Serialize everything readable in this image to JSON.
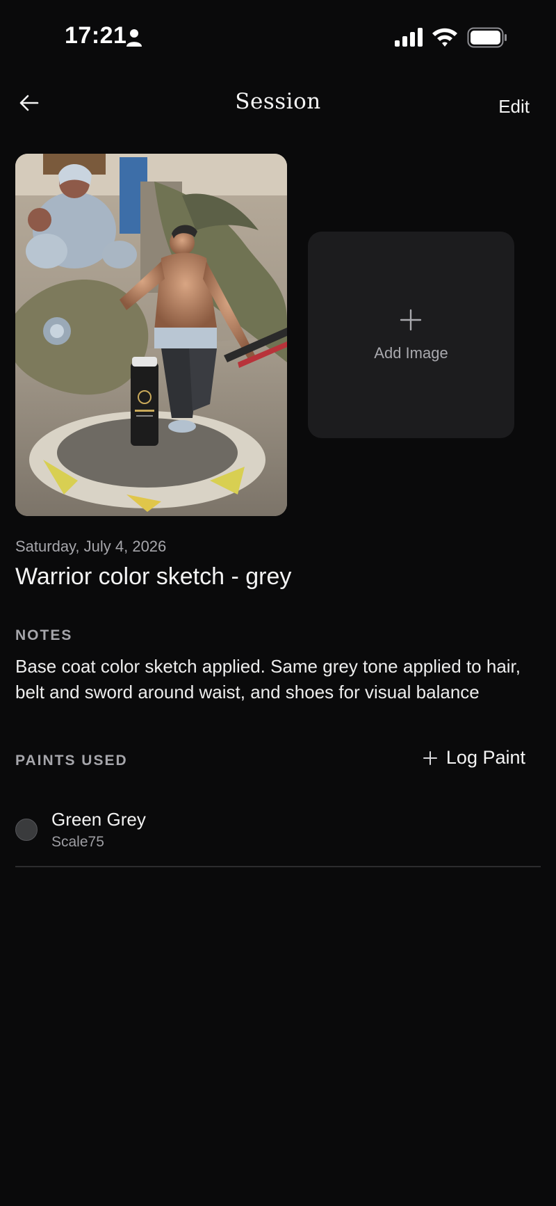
{
  "status_bar": {
    "time": "17:21",
    "icons": [
      "person-icon",
      "cellular-signal-icon",
      "wifi-icon",
      "battery-icon"
    ]
  },
  "nav": {
    "title": "Session",
    "edit_label": "Edit",
    "back_icon": "arrow-left-icon"
  },
  "gallery": {
    "photo_alt": "Painted figure of a warrior on a dragon base with a paint bottle",
    "add_image_label": "Add Image",
    "add_icon": "plus-icon"
  },
  "session": {
    "date": "Saturday, July 4, 2026",
    "title": "Warrior color sketch - grey"
  },
  "notes": {
    "heading": "NOTES",
    "body": "Base coat color sketch applied. Same grey tone applied to hair, belt and sword around waist, and shoes for visual balance"
  },
  "paints": {
    "heading": "PAINTS USED",
    "log_paint_label": "Log Paint",
    "items": [
      {
        "name": "Green Grey",
        "brand": "Scale75",
        "swatch_color": "#3a3b3d"
      }
    ]
  },
  "colors": {
    "background": "#0a0a0b",
    "tile": "#1c1c1e",
    "secondary_text": "#a6a6ab",
    "primary_text": "#f4f4f4"
  }
}
